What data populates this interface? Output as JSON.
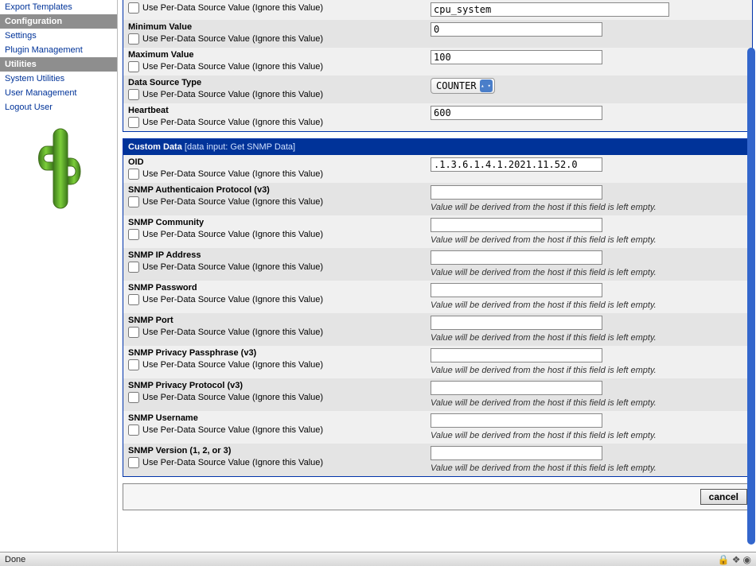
{
  "sidebar": {
    "items_top": [
      {
        "label": "Export Templates"
      }
    ],
    "group1": {
      "title": "Configuration"
    },
    "items_cfg": [
      {
        "label": "Settings"
      },
      {
        "label": "Plugin Management"
      }
    ],
    "group2": {
      "title": "Utilities"
    },
    "items_util": [
      {
        "label": "System Utilities"
      },
      {
        "label": "User Management"
      },
      {
        "label": "Logout User"
      }
    ]
  },
  "perdata_text": "Use Per-Data Source Value (Ignore this Value)",
  "derived_help": "Value will be derived from the host if this field is left empty.",
  "top_rows": [
    {
      "label": "",
      "value": "cpu_system",
      "show_checkbox": true,
      "kind": "text"
    },
    {
      "label": "Minimum Value",
      "value": "0",
      "show_checkbox": true,
      "kind": "text"
    },
    {
      "label": "Maximum Value",
      "value": "100",
      "show_checkbox": true,
      "kind": "text"
    },
    {
      "label": "Data Source Type",
      "value": "COUNTER",
      "show_checkbox": true,
      "kind": "dropdown"
    },
    {
      "label": "Heartbeat",
      "value": "600",
      "show_checkbox": true,
      "kind": "text"
    }
  ],
  "custom_header": {
    "title": "Custom Data",
    "sub": "[data input: Get SNMP Data]"
  },
  "custom_rows": [
    {
      "label": "OID",
      "value": ".1.3.6.1.4.1.2021.11.52.0",
      "help": false
    },
    {
      "label": "SNMP Authenticaion Protocol (v3)",
      "value": "",
      "help": true
    },
    {
      "label": "SNMP Community",
      "value": "",
      "help": true
    },
    {
      "label": "SNMP IP Address",
      "value": "",
      "help": true
    },
    {
      "label": "SNMP Password",
      "value": "",
      "help": true
    },
    {
      "label": "SNMP Port",
      "value": "",
      "help": true
    },
    {
      "label": "SNMP Privacy Passphrase (v3)",
      "value": "",
      "help": true
    },
    {
      "label": "SNMP Privacy Protocol (v3)",
      "value": "",
      "help": true
    },
    {
      "label": "SNMP Username",
      "value": "",
      "help": true
    },
    {
      "label": "SNMP Version (1, 2, or 3)",
      "value": "",
      "help": true
    }
  ],
  "footer": {
    "cancel": "cancel"
  },
  "status": {
    "done": "Done"
  }
}
